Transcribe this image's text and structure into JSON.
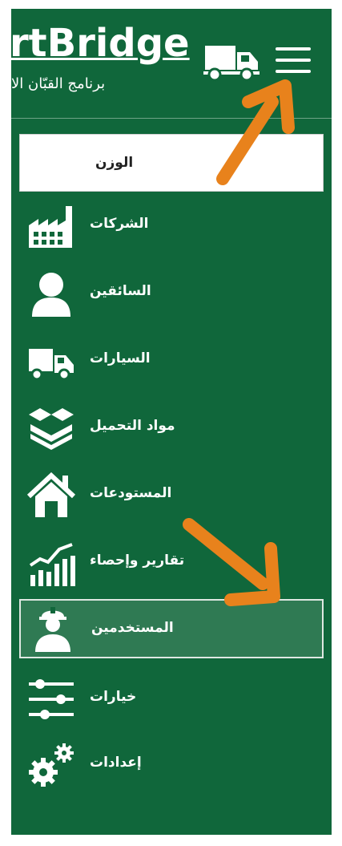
{
  "header": {
    "brand": "rtBridge",
    "subtitle": "برنامج القبّان الا",
    "truck_icon": "truck-icon",
    "menu_icon": "hamburger-icon"
  },
  "menu": [
    {
      "key": "weight",
      "label": "الوزن",
      "icon": "none",
      "state": "highlighted-white"
    },
    {
      "key": "companies",
      "label": "الشركات",
      "icon": "factory-icon"
    },
    {
      "key": "drivers",
      "label": "السائقين",
      "icon": "person-icon"
    },
    {
      "key": "vehicles",
      "label": "السيارات",
      "icon": "truck-icon"
    },
    {
      "key": "cargo",
      "label": "مواد التحميل",
      "icon": "boxes-icon"
    },
    {
      "key": "warehouses",
      "label": "المستودعات",
      "icon": "house-icon"
    },
    {
      "key": "reports",
      "label": "تقارير وإحصاء",
      "icon": "chart-icon"
    },
    {
      "key": "users",
      "label": "المستخدمين",
      "icon": "worker-icon",
      "state": "selected"
    },
    {
      "key": "options",
      "label": "خيارات",
      "icon": "sliders-icon"
    },
    {
      "key": "settings",
      "label": "إعدادات",
      "icon": "gears-icon"
    }
  ],
  "colors": {
    "sidebar": "#10673b",
    "selected": "#2f7a53",
    "annotation_arrow": "#e8821c"
  }
}
